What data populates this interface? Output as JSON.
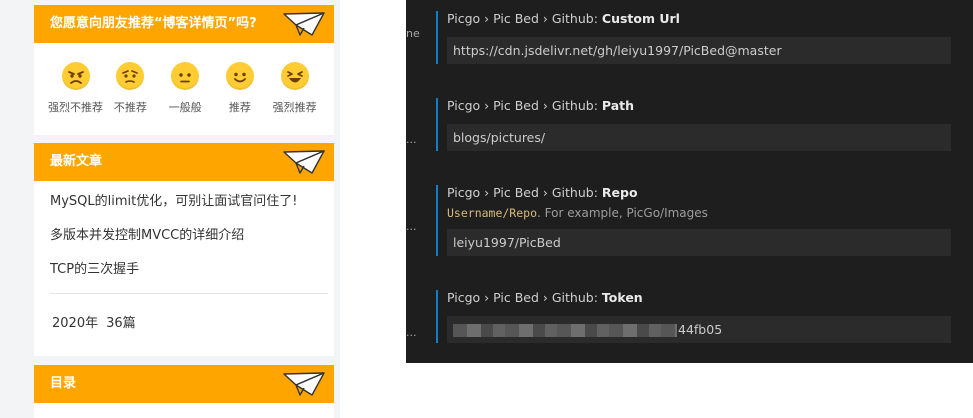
{
  "blog": {
    "recommend": {
      "title": "您愿意向朋友推荐“博客详情页”吗?",
      "options": [
        {
          "label": "强烈不推荐",
          "icon": "angry-face-icon"
        },
        {
          "label": "不推荐",
          "icon": "worried-face-icon"
        },
        {
          "label": "一般般",
          "icon": "neutral-face-icon"
        },
        {
          "label": "推荐",
          "icon": "smiling-face-icon"
        },
        {
          "label": "强烈推荐",
          "icon": "laughing-face-icon"
        }
      ]
    },
    "latest": {
      "title": "最新文章",
      "articles": [
        "MySQL的limit优化，可别让面试官问住了!",
        "多版本并发控制MVCC的详细介绍",
        "TCP的三次握手"
      ],
      "archive_year": "2020年",
      "archive_count": "36篇"
    },
    "toc": {
      "title": "目录"
    },
    "accent_color": "#ffa500"
  },
  "settings": {
    "edge_texts": [
      "ne",
      "...",
      "...",
      "..."
    ],
    "items": [
      {
        "prefix": "Picgo › Pic Bed › Github: ",
        "name": "Custom Url",
        "value": "https://cdn.jsdelivr.net/gh/leiyu1997/PicBed@master"
      },
      {
        "prefix": "Picgo › Pic Bed › Github: ",
        "name": "Path",
        "value": "blogs/pictures/"
      },
      {
        "prefix": "Picgo › Pic Bed › Github: ",
        "name": "Repo",
        "desc_code": "Username/Repo",
        "desc_text": ". For example, PicGo/Images",
        "value": "leiyu1997/PicBed"
      },
      {
        "prefix": "Picgo › Pic Bed › Github: ",
        "name": "Token",
        "value": "44fb05"
      }
    ],
    "colors": {
      "background": "#1e1e1e",
      "input": "#2b2b2b",
      "focus_bar": "#0e7fc8",
      "code": "#d7ba7d"
    }
  }
}
